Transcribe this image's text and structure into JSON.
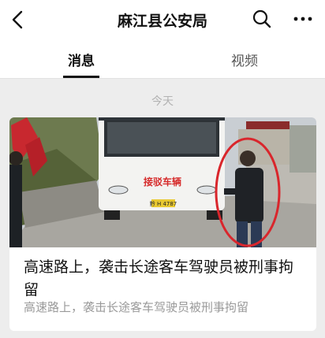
{
  "header": {
    "title": "麻江县公安局"
  },
  "tabs": [
    {
      "label": "消息",
      "active": true
    },
    {
      "label": "视频",
      "active": false
    }
  ],
  "feed": {
    "date_label": "今天",
    "article": {
      "title": "高速路上，袭击长途客车驾驶员被刑事拘留",
      "summary": "高速路上，袭击长途客车驾驶员被刑事拘留",
      "image": {
        "bus_sign": "接驳车辆",
        "plate": "黔 H 4787"
      }
    }
  },
  "colors": {
    "accent_text": "#111111",
    "secondary_text": "#9a9a9a",
    "background": "#ededed",
    "highlight_circle": "#d9262c"
  }
}
